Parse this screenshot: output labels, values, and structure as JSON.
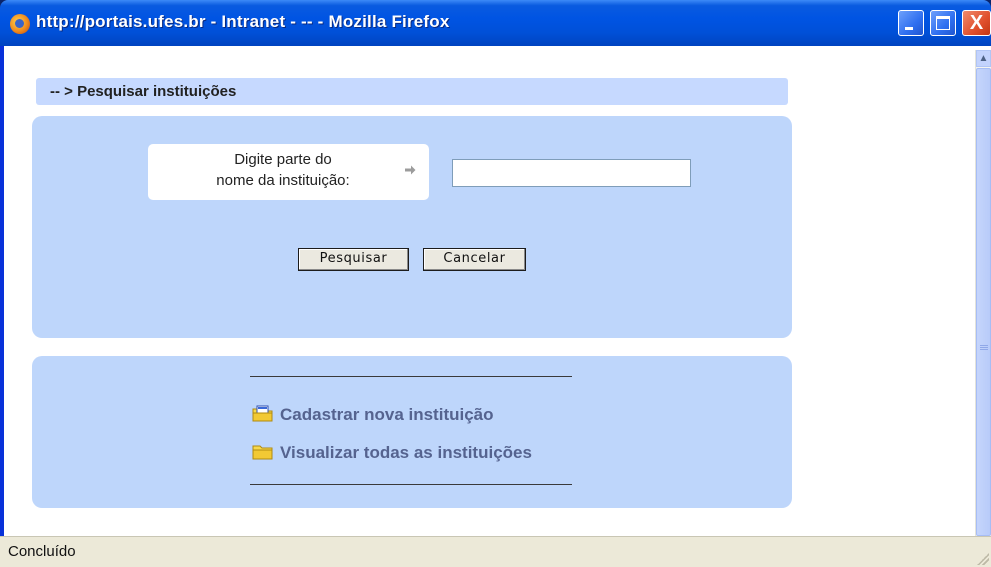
{
  "window": {
    "title": "http://portais.ufes.br - Intranet - -- - Mozilla Firefox",
    "minimize_symbol": "_",
    "maximize_symbol": "□",
    "close_symbol": "X"
  },
  "header": {
    "breadcrumb": "-- > Pesquisar instituições"
  },
  "search_form": {
    "label_line1": "Digite parte do",
    "label_line2": "nome da instituição:",
    "input_value": "",
    "search_button": "Pesquisar",
    "cancel_button": "Cancelar"
  },
  "links": {
    "register": "Cadastrar nova instituição",
    "view_all": "Visualizar todas as instituições"
  },
  "status": {
    "text": "Concluído"
  },
  "icons": {
    "arrow": "arrow-right-icon",
    "register": "folder-add-icon",
    "view_all": "folder-icon"
  },
  "colors": {
    "panel_bg": "#bed6fb",
    "header_bg": "#c6d9ff",
    "link_color": "#55638f",
    "titlebar": "#0054e3"
  }
}
